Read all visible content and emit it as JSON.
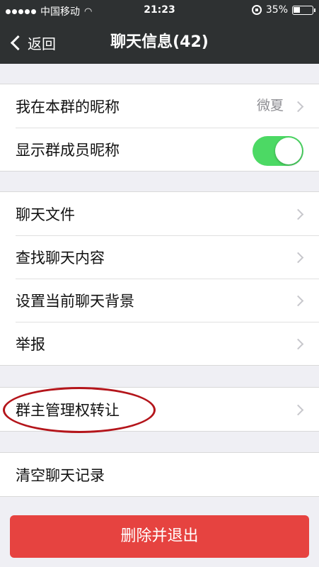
{
  "status_bar": {
    "carrier": "中国移动",
    "time": "21:23",
    "battery": "35%",
    "battery_level": 0.35
  },
  "nav": {
    "back_label": "返回",
    "title": "聊天信息(42)"
  },
  "group1": [
    {
      "label": "我在本群的昵称",
      "value": "微夏"
    },
    {
      "label": "显示群成员昵称",
      "toggle_on": true
    }
  ],
  "group2": [
    {
      "label": "聊天文件"
    },
    {
      "label": "查找聊天内容"
    },
    {
      "label": "设置当前聊天背景"
    },
    {
      "label": "举报"
    }
  ],
  "group3": [
    {
      "label": "群主管理权转让"
    }
  ],
  "group4": [
    {
      "label": "清空聊天记录"
    }
  ],
  "danger_button": {
    "label": "删除并退出",
    "color": "#e64340"
  },
  "colors": {
    "bar": "#2e3132",
    "toggle_on": "#4cd964",
    "highlight": "#b4151b"
  }
}
